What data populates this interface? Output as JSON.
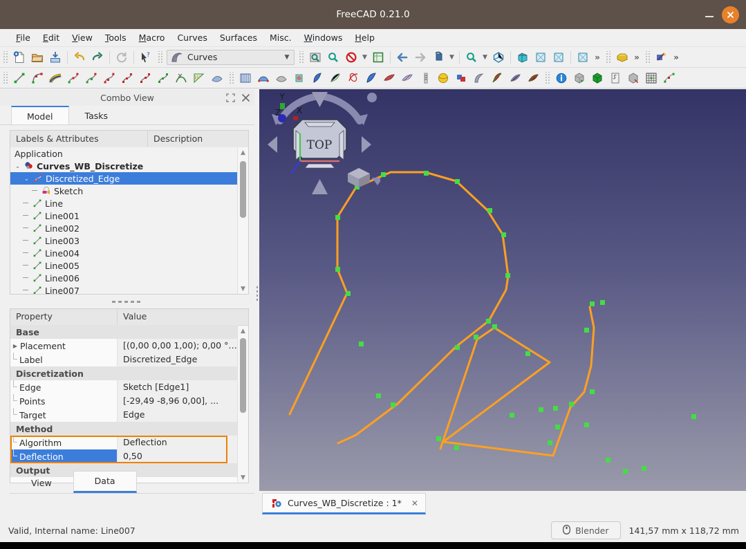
{
  "window": {
    "title": "FreeCAD 0.21.0",
    "minimize_label": "Minimize",
    "close_label": "Close"
  },
  "menubar": {
    "items": [
      {
        "label": "File",
        "mnemonic": "F"
      },
      {
        "label": "Edit",
        "mnemonic": "E"
      },
      {
        "label": "View",
        "mnemonic": "V"
      },
      {
        "label": "Tools",
        "mnemonic": "T"
      },
      {
        "label": "Macro",
        "mnemonic": "M"
      },
      {
        "label": "Curves",
        "mnemonic": ""
      },
      {
        "label": "Surfaces",
        "mnemonic": ""
      },
      {
        "label": "Misc.",
        "mnemonic": ""
      },
      {
        "label": "Windows",
        "mnemonic": "W"
      },
      {
        "label": "Help",
        "mnemonic": "H"
      }
    ]
  },
  "toolbar": {
    "workbench_selector": {
      "value": "Curves",
      "icon": "curves-workbench-icon"
    },
    "row1_icons": [
      "new-document-icon",
      "open-document-icon",
      "save-document-icon",
      "undo-icon",
      "redo-icon",
      "refresh-icon",
      "whats-this-icon"
    ],
    "row1_view_icons": [
      "fit-all-icon",
      "fit-selection-icon",
      "draw-style-icon",
      "std-view-box-icon",
      "view-back-icon",
      "view-forward-icon",
      "view-rotate-icon",
      "zoom-icon",
      "axonometric-icon",
      "front-view-icon",
      "top-view-icon",
      "right-view-icon",
      "isometric-view-icon"
    ],
    "row2_icons": [
      "line-icon",
      "bezier-curve-icon",
      "editable-spline-icon",
      "join-curve-icon",
      "split-curve-icon",
      "discretize-icon",
      "approximate-icon",
      "interpolate-icon",
      "parametric-blend-icon",
      "curve-extend-icon",
      "comb-plot-icon",
      "zebra-surface-icon",
      "isocurve-icon",
      "sublink-icon",
      "blend-surface-icon",
      "pipeshell-icon",
      "gordon-surface-icon",
      "profile-support-icon",
      "sweep2rails-icon",
      "segment-surface-icon",
      "flatten-face-icon",
      "sketch-on-surface-icon",
      "reflect-lines-icon",
      "mixed-curve-icon",
      "info-icon",
      "solid-from-shell-icon",
      "solid-icon",
      "selection-view-icon",
      "bounding-box-icon",
      "grid-icon",
      "paste-geometry-icon"
    ],
    "overflow_label": "»"
  },
  "combo_view": {
    "title": "Combo View",
    "float_button": "restore-icon",
    "close_button": "close-icon",
    "tabs": [
      {
        "label": "Model",
        "active": true
      },
      {
        "label": "Tasks",
        "active": false
      }
    ],
    "tree": {
      "columns": [
        "Labels & Attributes",
        "Description"
      ],
      "rows": [
        {
          "label": "Application",
          "depth": 0,
          "icon": "",
          "expander": "",
          "bold": false,
          "selected": false
        },
        {
          "label": "Curves_WB_Discretize",
          "depth": 0,
          "icon": "document-icon",
          "expander": "down",
          "bold": true,
          "selected": false
        },
        {
          "label": "Discretized_Edge",
          "depth": 1,
          "icon": "discretize-icon",
          "expander": "down",
          "bold": false,
          "selected": true
        },
        {
          "label": "Sketch",
          "depth": 2,
          "icon": "sketch-icon",
          "expander": "",
          "bold": false,
          "selected": false
        },
        {
          "label": "Line",
          "depth": 1,
          "icon": "line-icon",
          "expander": "",
          "bold": false,
          "selected": false
        },
        {
          "label": "Line001",
          "depth": 1,
          "icon": "line-icon",
          "expander": "",
          "bold": false,
          "selected": false
        },
        {
          "label": "Line002",
          "depth": 1,
          "icon": "line-icon",
          "expander": "",
          "bold": false,
          "selected": false
        },
        {
          "label": "Line003",
          "depth": 1,
          "icon": "line-icon",
          "expander": "",
          "bold": false,
          "selected": false
        },
        {
          "label": "Line004",
          "depth": 1,
          "icon": "line-icon",
          "expander": "",
          "bold": false,
          "selected": false
        },
        {
          "label": "Line005",
          "depth": 1,
          "icon": "line-icon",
          "expander": "",
          "bold": false,
          "selected": false
        },
        {
          "label": "Line006",
          "depth": 1,
          "icon": "line-icon",
          "expander": "",
          "bold": false,
          "selected": false
        },
        {
          "label": "Line007",
          "depth": 1,
          "icon": "line-icon",
          "expander": "",
          "bold": false,
          "selected": false
        }
      ]
    },
    "property_editor": {
      "columns": [
        "Property",
        "Value"
      ],
      "rows": [
        {
          "kind": "group",
          "name": "Base",
          "value": ""
        },
        {
          "kind": "prop",
          "name": "Placement",
          "value": "[(0,00 0,00 1,00); 0,00 °; ...",
          "expandable": true,
          "selected": false
        },
        {
          "kind": "prop",
          "name": "Label",
          "value": "Discretized_Edge",
          "expandable": false,
          "selected": false
        },
        {
          "kind": "group",
          "name": "Discretization",
          "value": ""
        },
        {
          "kind": "prop",
          "name": "Edge",
          "value": "Sketch [Edge1]",
          "expandable": false,
          "selected": false
        },
        {
          "kind": "prop",
          "name": "Points",
          "value": "[-29,49 -8,96 0,00], ...",
          "expandable": false,
          "selected": false
        },
        {
          "kind": "prop",
          "name": "Target",
          "value": "Edge",
          "expandable": false,
          "selected": false
        },
        {
          "kind": "group",
          "name": "Method",
          "value": ""
        },
        {
          "kind": "prop",
          "name": "Algorithm",
          "value": "Deflection",
          "expandable": false,
          "selected": false,
          "highlight": true
        },
        {
          "kind": "prop",
          "name": "Deflection",
          "value": "0,50",
          "expandable": false,
          "selected": true,
          "highlight": true
        },
        {
          "kind": "group",
          "name": "Output",
          "value": ""
        }
      ],
      "highlight_color": "#f08000"
    },
    "bottom_tabs": [
      {
        "label": "View",
        "active": false
      },
      {
        "label": "Data",
        "active": true
      }
    ]
  },
  "view3d": {
    "nav_cube_label": "TOP",
    "axis_labels": {
      "x": "X",
      "y": "Y",
      "z": "Z"
    },
    "axis_colors": {
      "x": "#aa3333",
      "y": "#33aa33",
      "z": "#3333bb"
    },
    "curve_color": "#ffa020",
    "point_color": "#44dd44",
    "background_top": "#333366",
    "background_bottom": "#9a9aab"
  },
  "document_tab": {
    "label": "Curves_WB_Discretize : 1*",
    "icon": "freecad-document-icon",
    "close_label": "✕"
  },
  "statusbar": {
    "message": "Valid, Internal name: Line007",
    "nav_style": "Blender",
    "nav_icon": "mouse-icon",
    "dimensions": "141,57 mm x 118,72 mm"
  }
}
